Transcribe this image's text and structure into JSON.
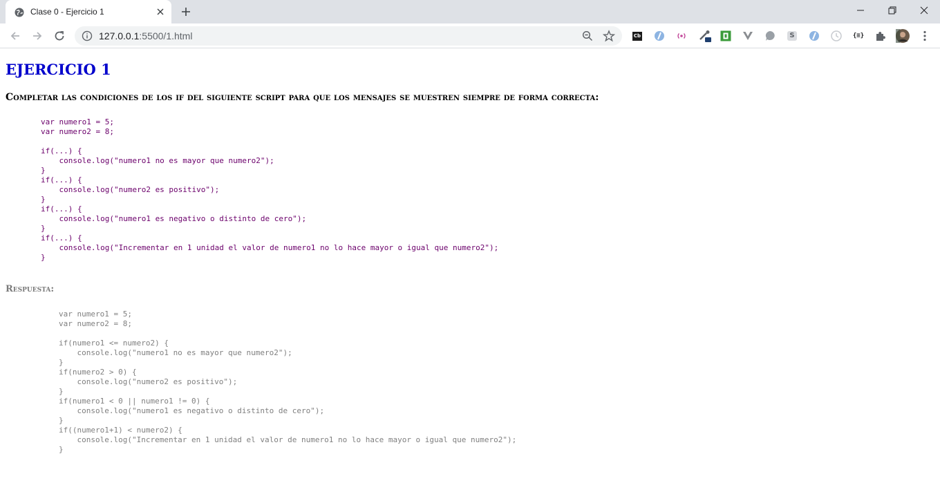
{
  "browser": {
    "tab_title": "Clase 0 - Ejercicio 1",
    "url_host": "127.0.0.1",
    "url_rest": ":5500/1.html",
    "extensions": [
      "cb-icon",
      "blue-o-icon",
      "radio-icon",
      "dropper-icon",
      "green-square-icon",
      "v-icon",
      "bubble-icon",
      "s-icon",
      "blue-o2-icon",
      "clock-icon",
      "json-icon",
      "puzzle-icon",
      "avatar"
    ],
    "ext_labels": {
      "cb": "Cb",
      "s": "S",
      "json": "{≡}"
    }
  },
  "page": {
    "title": "EJERCICIO 1",
    "subtitle": "Completar las condiciones de los if del siguiente script para que los mensajes se muestren siempre de forma correcta:",
    "question_code": "var numero1 = 5;\nvar numero2 = 8;\n\nif(...) {\n    console.log(\"numero1 no es mayor que numero2\");\n}\nif(...) {\n    console.log(\"numero2 es positivo\");\n}\nif(...) {\n    console.log(\"numero1 es negativo o distinto de cero\");\n}\nif(...) {\n    console.log(\"Incrementar en 1 unidad el valor de numero1 no lo hace mayor o igual que numero2\");\n}",
    "answer_heading": "Respuesta:",
    "answer_code": "var numero1 = 5;\nvar numero2 = 8;\n\nif(numero1 <= numero2) {\n    console.log(\"numero1 no es mayor que numero2\");\n}\nif(numero2 > 0) {\n    console.log(\"numero2 es positivo\");\n}\nif(numero1 < 0 || numero1 != 0) {\n    console.log(\"numero1 es negativo o distinto de cero\");\n}\nif((numero1+1) < numero2) {\n    console.log(\"Incrementar en 1 unidad el valor de numero1 no lo hace mayor o igual que numero2\");\n}"
  }
}
